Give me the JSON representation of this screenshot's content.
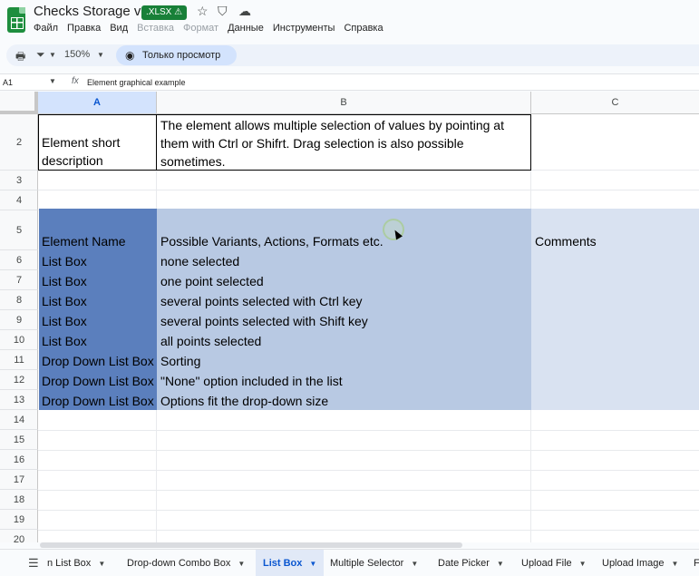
{
  "header": {
    "doc_title": "Checks Storage v9",
    "badge": ".XLSX ⚠",
    "menu": [
      "Файл",
      "Правка",
      "Вид",
      "Вставка",
      "Формат",
      "Данные",
      "Инструменты",
      "Справка"
    ]
  },
  "toolbar": {
    "zoom": "150%",
    "view_only": "Только просмотр"
  },
  "formula_bar": {
    "cell_ref": "A1",
    "fx": "fx",
    "content": "Element graphical example"
  },
  "grid": {
    "columns": [
      "A",
      "B",
      "C"
    ],
    "rows": [
      "2",
      "3",
      "4",
      "5",
      "6",
      "7",
      "8",
      "9",
      "10",
      "11",
      "12",
      "13",
      "14",
      "15",
      "16",
      "17",
      "18",
      "19",
      "20"
    ],
    "r2": {
      "a_line1": "Element short",
      "a_line2": "description",
      "b_line1": "The element allows multiple selection of values by pointing at",
      "b_line2": "them with Ctrl or Shifrt. Drag selection is also possible",
      "b_line3": "sometimes."
    },
    "r5": {
      "a": "Element Name",
      "b": "Possible Variants, Actions, Formats etc.",
      "c": "Comments"
    },
    "table_rows": [
      {
        "a": "List Box",
        "b": "none selected"
      },
      {
        "a": "List Box",
        "b": "one point selected"
      },
      {
        "a": "List Box",
        "b": "several points selected with Ctrl key"
      },
      {
        "a": "List Box",
        "b": "several points selected with Shift key"
      },
      {
        "a": "List Box",
        "b": "all points selected"
      },
      {
        "a": "Drop Down List Box",
        "b": "Sorting"
      },
      {
        "a": "Drop Down List Box",
        "b": "\"None\" option included in the list"
      },
      {
        "a": "Drop Down List Box",
        "b": "Options fit the drop-down size"
      }
    ]
  },
  "sheet_tabs": [
    {
      "label": "n List Box",
      "active": false
    },
    {
      "label": "Drop-down Combo Box",
      "active": false
    },
    {
      "label": "List Box",
      "active": true
    },
    {
      "label": "Multiple Selector",
      "active": false
    },
    {
      "label": "Date Picker",
      "active": false
    },
    {
      "label": "Upload File",
      "active": false
    },
    {
      "label": "Upload Image",
      "active": false
    },
    {
      "label": "F",
      "active": false
    }
  ],
  "colors": {
    "header_fill_a": "#5b7fbd",
    "header_fill_b": "#b8c9e3",
    "header_fill_c": "#d9e2f1",
    "badge_green": "#188038",
    "active_tab": "#0b57d0"
  }
}
